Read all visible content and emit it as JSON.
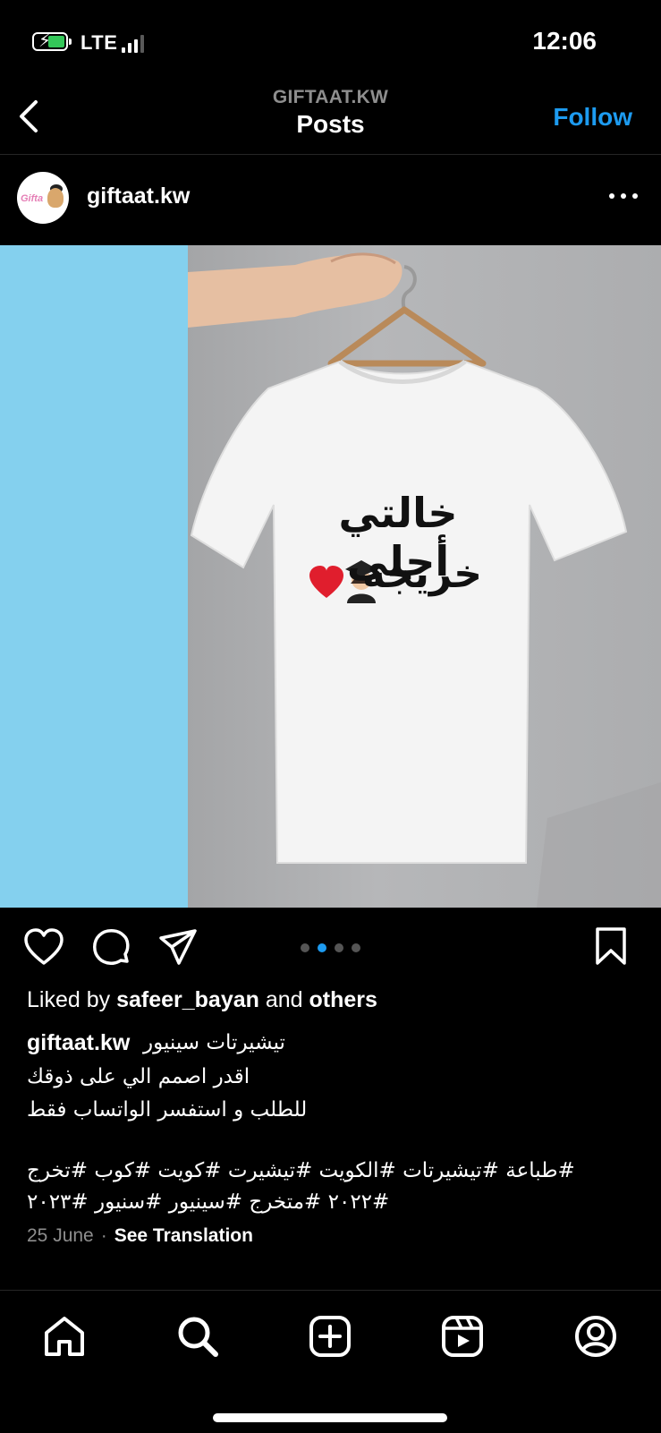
{
  "status_bar": {
    "network": "LTE",
    "time": "12:06"
  },
  "nav": {
    "account": "GIFTAAT.KW",
    "title": "Posts",
    "follow_label": "Follow"
  },
  "post": {
    "username": "giftaat.kw",
    "image": {
      "design_line1": "خالتي أحلى",
      "design_line2": "خريجة",
      "carousel_count": 4,
      "carousel_active": 2
    },
    "likes": {
      "prefix": "Liked by",
      "user": "safeer_bayan",
      "mid": "and",
      "suffix": "others"
    },
    "caption": {
      "username": "giftaat.kw",
      "lines": [
        "تيشيرتات سينيور",
        "اقدر اصمم الي على ذوقك",
        "للطلب و استفسر الواتساب فقط",
        "#طباعة #تيشيرتات #الكويت #تيشيرت #كويت #كوب #تخرج",
        "#٢٠٢٢ #متخرج #سينيور #سنيور #٢٠٢٣"
      ]
    },
    "date": "25 June",
    "translate_label": "See Translation"
  },
  "tab_bar": {
    "items": [
      "home-icon",
      "search-icon",
      "create-icon",
      "reels-icon",
      "profile-icon"
    ]
  },
  "colors": {
    "accent": "#1d9bf0",
    "background": "#000000",
    "muted": "#8e8e8e",
    "battery": "#34c759"
  }
}
